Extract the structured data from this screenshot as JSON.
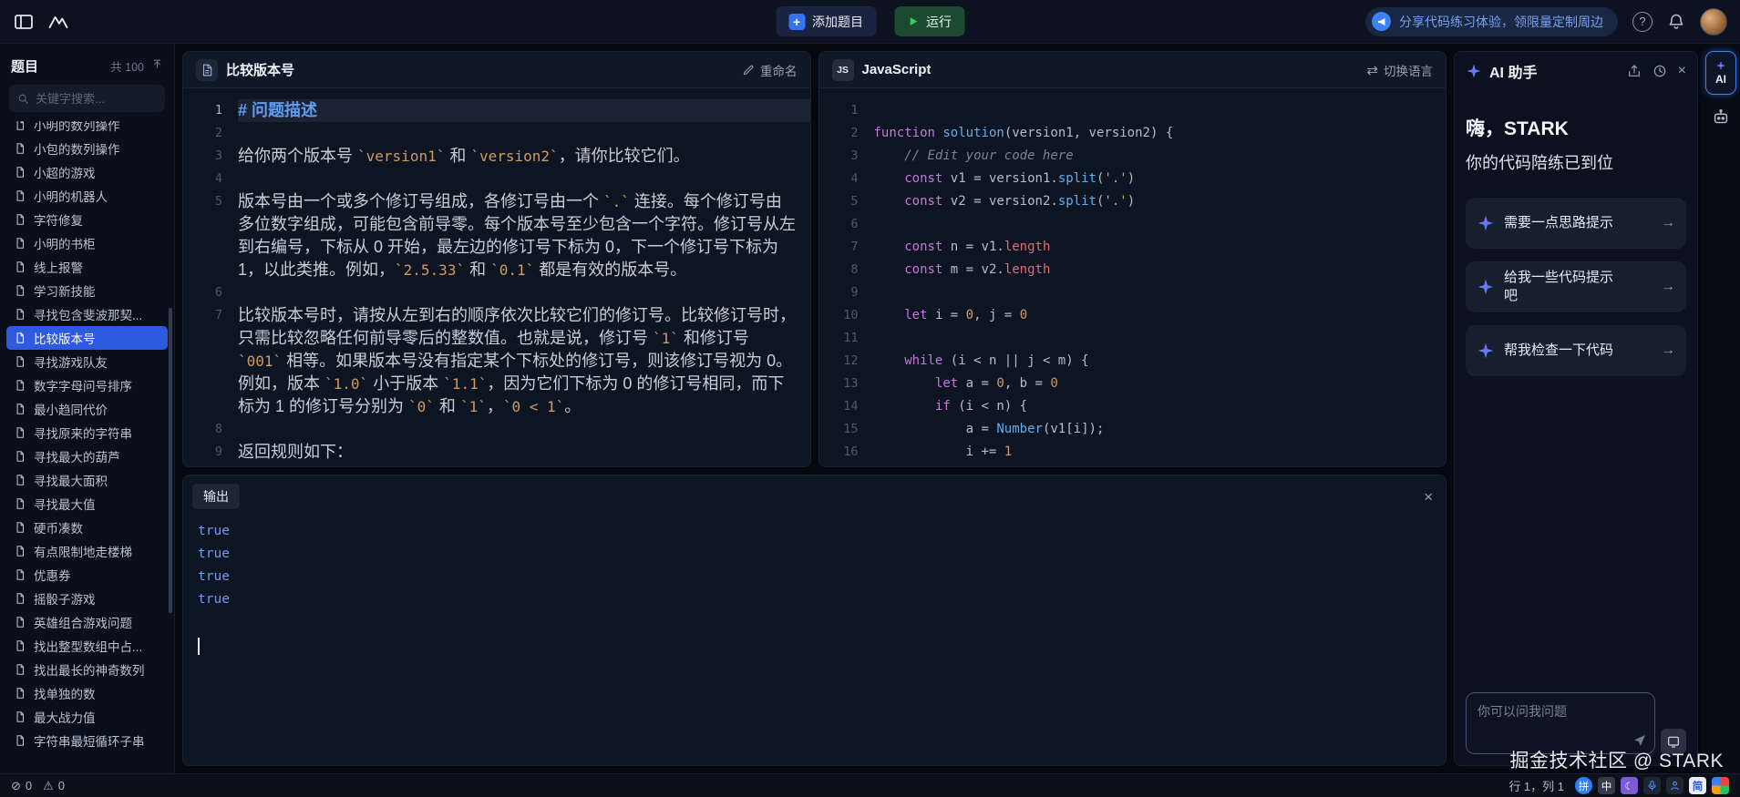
{
  "topbar": {
    "add_problem_label": "添加题目",
    "run_label": "运行",
    "banner_text": "分享代码练习体验，领限量定制周边"
  },
  "sidebar": {
    "title": "题目",
    "count": "共 100",
    "search_placeholder": "关键字搜索...",
    "items": [
      {
        "label": "小明的数列操作",
        "selected": false
      },
      {
        "label": "小包的数列操作",
        "selected": false
      },
      {
        "label": "小超的游戏",
        "selected": false
      },
      {
        "label": "小明的机器人",
        "selected": false
      },
      {
        "label": "字符修复",
        "selected": false
      },
      {
        "label": "小明的书柜",
        "selected": false
      },
      {
        "label": "线上报警",
        "selected": false
      },
      {
        "label": "学习新技能",
        "selected": false
      },
      {
        "label": "寻找包含斐波那契...",
        "selected": false
      },
      {
        "label": "比较版本号",
        "selected": true
      },
      {
        "label": "寻找游戏队友",
        "selected": false
      },
      {
        "label": "数字字母问号排序",
        "selected": false
      },
      {
        "label": "最小趋同代价",
        "selected": false
      },
      {
        "label": "寻找原来的字符串",
        "selected": false
      },
      {
        "label": "寻找最大的葫芦",
        "selected": false
      },
      {
        "label": "寻找最大面积",
        "selected": false
      },
      {
        "label": "寻找最大值",
        "selected": false
      },
      {
        "label": "硬币凑数",
        "selected": false
      },
      {
        "label": "有点限制地走楼梯",
        "selected": false
      },
      {
        "label": "优惠券",
        "selected": false
      },
      {
        "label": "摇骰子游戏",
        "selected": false
      },
      {
        "label": "英雄组合游戏问题",
        "selected": false
      },
      {
        "label": "找出整型数组中占...",
        "selected": false
      },
      {
        "label": "找出最长的神奇数列",
        "selected": false
      },
      {
        "label": "找单独的数",
        "selected": false
      },
      {
        "label": "最大战力值",
        "selected": false
      },
      {
        "label": "字符串最短循环子串",
        "selected": false
      }
    ]
  },
  "problem": {
    "title": "比较版本号",
    "rename_label": "重命名",
    "lines": [
      {
        "num": "1",
        "highlight": true,
        "segs": [
          {
            "t": "h",
            "s": "# 问题描述"
          }
        ]
      },
      {
        "num": "2",
        "segs": []
      },
      {
        "num": "3",
        "segs": [
          {
            "t": "x",
            "s": "给你两个版本号 "
          },
          {
            "t": "c",
            "s": "`version1`"
          },
          {
            "t": "x",
            "s": " 和 "
          },
          {
            "t": "c",
            "s": "`version2`"
          },
          {
            "t": "x",
            "s": "，请你比较它们。"
          }
        ]
      },
      {
        "num": "4",
        "segs": []
      },
      {
        "num": "5",
        "segs": [
          {
            "t": "x",
            "s": "版本号由一个或多个修订号组成，各修订号由一个 "
          },
          {
            "t": "c",
            "s": "`.`"
          },
          {
            "t": "x",
            "s": " 连接。每个修订号由多位数字组成，可能包含前导零。每个版本号至少包含一个字符。修订号从左到右编号，下标从 0 开始，最左边的修订号下标为 0，下一个修订号下标为 1，以此类推。例如，"
          },
          {
            "t": "c",
            "s": "`2.5.33`"
          },
          {
            "t": "x",
            "s": " 和 "
          },
          {
            "t": "c",
            "s": "`0.1`"
          },
          {
            "t": "x",
            "s": " 都是有效的版本号。"
          }
        ]
      },
      {
        "num": "6",
        "segs": []
      },
      {
        "num": "7",
        "segs": [
          {
            "t": "x",
            "s": "比较版本号时，请按从左到右的顺序依次比较它们的修订号。比较修订号时，只需比较忽略任何前导零后的整数值。也就是说，修订号 "
          },
          {
            "t": "c",
            "s": "`1`"
          },
          {
            "t": "x",
            "s": " 和修订号 "
          },
          {
            "t": "c",
            "s": "`001`"
          },
          {
            "t": "x",
            "s": " 相等。如果版本号没有指定某个下标处的修订号，则该修订号视为 0。例如，版本 "
          },
          {
            "t": "c",
            "s": "`1.0`"
          },
          {
            "t": "x",
            "s": " 小于版本 "
          },
          {
            "t": "c",
            "s": "`1.1`"
          },
          {
            "t": "x",
            "s": "，因为它们下标为 0 的修订号相同，而下标为 1 的修订号分别为 "
          },
          {
            "t": "c",
            "s": "`0`"
          },
          {
            "t": "x",
            "s": " 和 "
          },
          {
            "t": "c",
            "s": "`1`"
          },
          {
            "t": "x",
            "s": "，"
          },
          {
            "t": "c",
            "s": "`0 < 1`"
          },
          {
            "t": "x",
            "s": "。"
          }
        ]
      },
      {
        "num": "8",
        "segs": []
      },
      {
        "num": "9",
        "segs": [
          {
            "t": "x",
            "s": "返回规则如下："
          }
        ]
      }
    ]
  },
  "code_panel": {
    "lang_badge": "JS",
    "lang_name": "JavaScript",
    "switch_language_label": "切换语言",
    "lines": [
      {
        "num": "1",
        "toks": []
      },
      {
        "num": "2",
        "toks": [
          {
            "c": "kw",
            "s": "function"
          },
          {
            "c": "d",
            "s": " "
          },
          {
            "c": "fn",
            "s": "solution"
          },
          {
            "c": "d",
            "s": "(version1, version2) {"
          }
        ]
      },
      {
        "num": "3",
        "toks": [
          {
            "c": "d",
            "s": "    "
          },
          {
            "c": "cm",
            "s": "// Edit your code here"
          }
        ]
      },
      {
        "num": "4",
        "toks": [
          {
            "c": "d",
            "s": "    "
          },
          {
            "c": "kw",
            "s": "const"
          },
          {
            "c": "d",
            "s": " v1 = version1."
          },
          {
            "c": "fn",
            "s": "split"
          },
          {
            "c": "d",
            "s": "("
          },
          {
            "c": "str",
            "s": "'.'"
          },
          {
            "c": "d",
            "s": ")"
          }
        ]
      },
      {
        "num": "5",
        "toks": [
          {
            "c": "d",
            "s": "    "
          },
          {
            "c": "kw",
            "s": "const"
          },
          {
            "c": "d",
            "s": " v2 = version2."
          },
          {
            "c": "fn",
            "s": "split"
          },
          {
            "c": "d",
            "s": "("
          },
          {
            "c": "str",
            "s": "'.'"
          },
          {
            "c": "d",
            "s": ")"
          }
        ]
      },
      {
        "num": "6",
        "toks": []
      },
      {
        "num": "7",
        "toks": [
          {
            "c": "d",
            "s": "    "
          },
          {
            "c": "kw",
            "s": "const"
          },
          {
            "c": "d",
            "s": " n = v1."
          },
          {
            "c": "prop",
            "s": "length"
          }
        ]
      },
      {
        "num": "8",
        "toks": [
          {
            "c": "d",
            "s": "    "
          },
          {
            "c": "kw",
            "s": "const"
          },
          {
            "c": "d",
            "s": " m = v2."
          },
          {
            "c": "prop",
            "s": "length"
          }
        ]
      },
      {
        "num": "9",
        "toks": []
      },
      {
        "num": "10",
        "toks": [
          {
            "c": "d",
            "s": "    "
          },
          {
            "c": "kw",
            "s": "let"
          },
          {
            "c": "d",
            "s": " i = "
          },
          {
            "c": "num",
            "s": "0"
          },
          {
            "c": "d",
            "s": ", j = "
          },
          {
            "c": "num",
            "s": "0"
          }
        ]
      },
      {
        "num": "11",
        "toks": []
      },
      {
        "num": "12",
        "toks": [
          {
            "c": "d",
            "s": "    "
          },
          {
            "c": "kw",
            "s": "while"
          },
          {
            "c": "d",
            "s": " (i < n || j < m) {"
          }
        ]
      },
      {
        "num": "13",
        "toks": [
          {
            "c": "d",
            "s": "        "
          },
          {
            "c": "kw",
            "s": "let"
          },
          {
            "c": "d",
            "s": " a = "
          },
          {
            "c": "num",
            "s": "0"
          },
          {
            "c": "d",
            "s": ", b = "
          },
          {
            "c": "num",
            "s": "0"
          }
        ]
      },
      {
        "num": "14",
        "toks": [
          {
            "c": "d",
            "s": "        "
          },
          {
            "c": "kw",
            "s": "if"
          },
          {
            "c": "d",
            "s": " (i < n) {"
          }
        ]
      },
      {
        "num": "15",
        "toks": [
          {
            "c": "d",
            "s": "            a = "
          },
          {
            "c": "fn",
            "s": "Number"
          },
          {
            "c": "d",
            "s": "(v1[i]);"
          }
        ]
      },
      {
        "num": "16",
        "toks": [
          {
            "c": "d",
            "s": "            i += "
          },
          {
            "c": "num",
            "s": "1"
          }
        ]
      }
    ]
  },
  "output_panel": {
    "tab": "输出",
    "lines": [
      "true",
      "true",
      "true",
      "true"
    ]
  },
  "ai_panel": {
    "title": "AI 助手",
    "greeting": "嗨，STARK",
    "subtitle": "你的代码陪练已到位",
    "suggestions": [
      {
        "label": "需要一点思路提示"
      },
      {
        "label": "给我一些代码提示吧"
      },
      {
        "label": "帮我检查一下代码"
      }
    ],
    "input_placeholder": "你可以问我问题"
  },
  "right_rail": {
    "ai_badge": "AI"
  },
  "statusbar": {
    "errors": "0",
    "warnings": "0",
    "cursor_position": "行 1，列 1",
    "ime": [
      {
        "name": "ime-pinyin",
        "glyph": "拼"
      },
      {
        "name": "ime-chinese-mode",
        "glyph": "中"
      },
      {
        "name": "ime-fullwidth-moon",
        "glyph": "☾"
      },
      {
        "name": "ime-mic",
        "glyph": ""
      },
      {
        "name": "ime-contacts",
        "glyph": ""
      },
      {
        "name": "ime-simplified",
        "glyph": "简"
      },
      {
        "name": "ime-toolbox",
        "glyph": ""
      }
    ]
  },
  "watermark": "掘金技术社区 @ STARK",
  "colors": {
    "accent_blue": "#2d5ae0",
    "run_green": "#34d063",
    "banner_text_blue": "#7aa0f2",
    "output_value_blue": "#6e9bf5",
    "keyword_purple": "#c678dd",
    "string_green": "#98c379"
  }
}
